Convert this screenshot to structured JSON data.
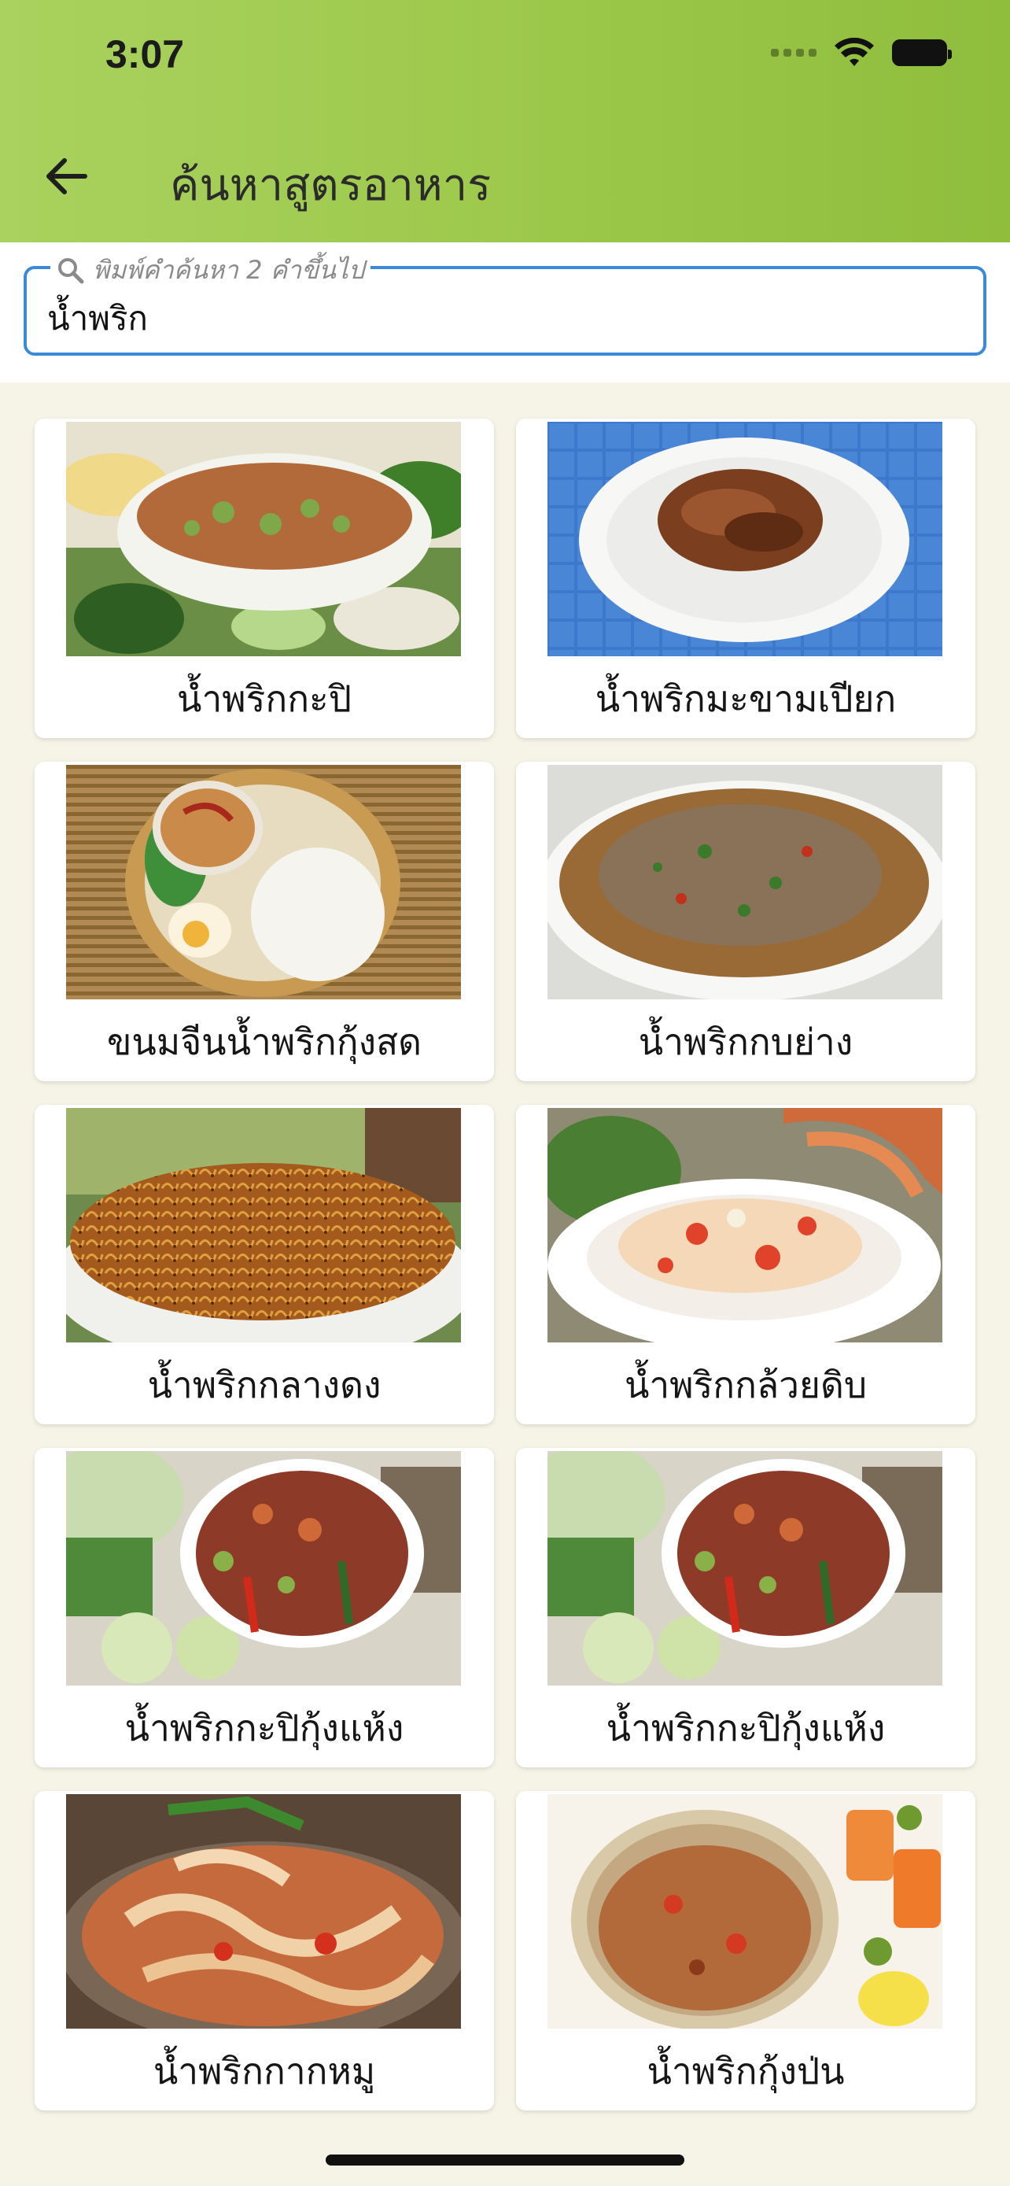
{
  "status_bar": {
    "time": "3:07"
  },
  "header": {
    "title": "ค้นหาสูตรอาหาร",
    "background": "#9cc84a"
  },
  "search": {
    "placeholder": "พิมพ์คำค้นหา 2 คำขึ้นไป",
    "value": "น้ำพริก",
    "accent": "#3b8ad8"
  },
  "results": [
    {
      "label": "น้ำพริกกะปิ",
      "image": "bowl-chili-paste-vegetables"
    },
    {
      "label": "น้ำพริกมะขามเปียก",
      "image": "plate-tamarind-chili-paste"
    },
    {
      "label": "ขนมจีนน้ำพริกกุ้งสด",
      "image": "rice-noodles-shrimp-dip"
    },
    {
      "label": "น้ำพริกกบย่าง",
      "image": "bowl-grilled-frog-chili"
    },
    {
      "label": "น้ำพริกกลางดง",
      "image": "bowl-fried-chili-mix"
    },
    {
      "label": "น้ำพริกกล้วยดิบ",
      "image": "bowl-banana-chili-prawn"
    },
    {
      "label": "น้ำพริกกะปิกุ้งแห้ง",
      "image": "bowl-shrimp-paste-chili"
    },
    {
      "label": "น้ำพริกกะปิกุ้งแห้ง",
      "image": "bowl-shrimp-paste-chili"
    },
    {
      "label": "น้ำพริกกากหมู",
      "image": "plate-pork-crackling-chili"
    },
    {
      "label": "น้ำพริกกุ้งป่น",
      "image": "jar-ground-shrimp-chili"
    }
  ]
}
